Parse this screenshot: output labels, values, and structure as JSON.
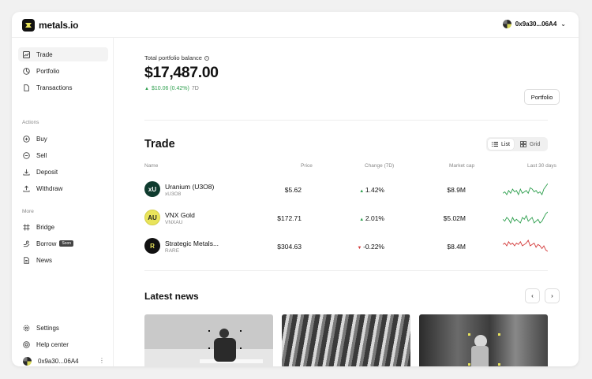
{
  "brand": {
    "name": "metals.io"
  },
  "wallet": {
    "address": "0x9a30...06A4"
  },
  "sidebar": {
    "main_items": [
      {
        "label": "Trade",
        "icon": "trend-chart-icon",
        "active": true
      },
      {
        "label": "Portfolio",
        "icon": "pie-chart-icon"
      },
      {
        "label": "Transactions",
        "icon": "document-icon"
      }
    ],
    "actions_label": "Actions",
    "actions_items": [
      {
        "label": "Buy",
        "icon": "plus-circle-icon"
      },
      {
        "label": "Sell",
        "icon": "minus-circle-icon"
      },
      {
        "label": "Deposit",
        "icon": "download-icon"
      },
      {
        "label": "Withdraw",
        "icon": "upload-icon"
      }
    ],
    "more_label": "More",
    "more_items": [
      {
        "label": "Bridge",
        "icon": "bridge-icon"
      },
      {
        "label": "Borrow",
        "icon": "borrow-icon",
        "badge": "Soon"
      },
      {
        "label": "News",
        "icon": "news-icon"
      }
    ],
    "bottom_items": [
      {
        "label": "Settings",
        "icon": "gear-icon"
      },
      {
        "label": "Help center",
        "icon": "help-icon"
      }
    ],
    "user_address": "0x9a30...06A4"
  },
  "balance": {
    "label": "Total portfolio balance",
    "value": "$17,487.00",
    "change": "$10.06 (0.42%)",
    "period": "7D",
    "portfolio_button": "Portfolio"
  },
  "trade": {
    "title": "Trade",
    "view_list": "List",
    "view_grid": "Grid",
    "columns": {
      "name": "Name",
      "price": "Price",
      "change": "Change (7D)",
      "market_cap": "Market cap",
      "last_30": "Last 30 days"
    },
    "rows": [
      {
        "name": "Uranium (U3O8)",
        "symbol": "xU3O8",
        "icon_text": "xU",
        "price": "$5.62",
        "change": "1.42%",
        "direction": "up",
        "market_cap": "$8.9M",
        "spark": [
          6,
          7,
          5,
          8,
          6,
          9,
          7,
          8,
          5,
          9,
          6,
          7,
          8,
          6,
          10,
          9,
          7,
          8,
          6,
          7,
          5,
          9,
          11,
          13
        ]
      },
      {
        "name": "VNX Gold",
        "symbol": "VNXAU",
        "icon_text": "AU",
        "price": "$172.71",
        "change": "2.01%",
        "direction": "up",
        "market_cap": "$5.02M",
        "spark": [
          8,
          7,
          9,
          8,
          6,
          9,
          7,
          8,
          7,
          6,
          9,
          8,
          10,
          7,
          8,
          9,
          6,
          7,
          8,
          6,
          7,
          9,
          11,
          12
        ]
      },
      {
        "name": "Strategic Metals...",
        "symbol": "RARE",
        "icon_text": "R",
        "price": "$304.63",
        "change": "-0.22%",
        "direction": "down",
        "market_cap": "$8.4M",
        "spark": [
          9,
          10,
          8,
          11,
          9,
          10,
          8,
          10,
          9,
          11,
          8,
          9,
          10,
          12,
          8,
          9,
          10,
          7,
          9,
          8,
          6,
          8,
          5,
          4
        ]
      }
    ]
  },
  "news": {
    "title": "Latest news",
    "prev": "‹",
    "next": "›"
  },
  "colors": {
    "up": "#2e9f4e",
    "down": "#d43b3b",
    "brand_yellow": "#e9e45b"
  }
}
